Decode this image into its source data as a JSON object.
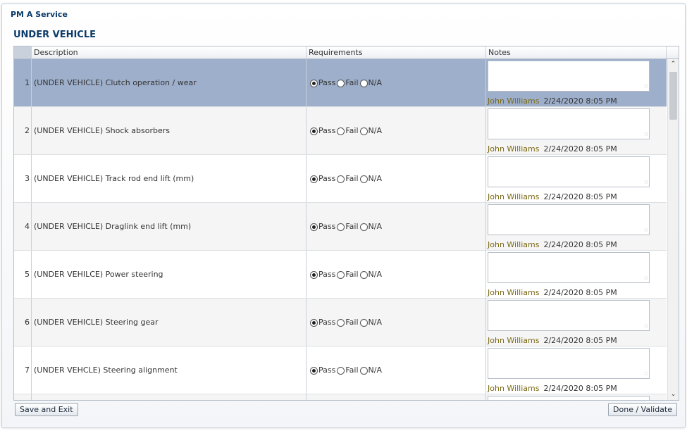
{
  "window": {
    "title": "PM A Service"
  },
  "section": {
    "title": "UNDER VEHICLE"
  },
  "table": {
    "columns": [
      "Description",
      "Requirements",
      "Notes"
    ],
    "radio_labels": [
      "Pass",
      "Fail",
      "N/A"
    ],
    "rows": [
      {
        "num": "1",
        "description": "(UNDER VEHICLE) Clutch operation / wear",
        "selected_option": "Pass",
        "note_text": "",
        "user": "John Williams",
        "date": "2/24/2020 8:05 PM",
        "highlight": true
      },
      {
        "num": "2",
        "description": "(UNDER VEHICLE) Shock absorbers",
        "selected_option": "Pass",
        "note_text": "",
        "user": "John Williams",
        "date": "2/24/2020 8:05 PM"
      },
      {
        "num": "3",
        "description": "(UNDER VEHICLE) Track rod end lift (mm)",
        "selected_option": "Pass",
        "note_text": "",
        "user": "John Williams",
        "date": "2/24/2020 8:05 PM"
      },
      {
        "num": "4",
        "description": "(UNDER VEHICLE) Draglink end lift (mm)",
        "selected_option": "Pass",
        "note_text": "",
        "user": "John Williams",
        "date": "2/24/2020 8:05 PM"
      },
      {
        "num": "5",
        "description": "(UNDER VEHILCE) Power steering",
        "selected_option": "Pass",
        "note_text": "",
        "user": "John Williams",
        "date": "2/24/2020 8:05 PM"
      },
      {
        "num": "6",
        "description": "(UNDER VEHICLE) Steering gear",
        "selected_option": "Pass",
        "note_text": "",
        "user": "John Williams",
        "date": "2/24/2020 8:05 PM"
      },
      {
        "num": "7",
        "description": "(UNDER VEHCLE) Steering alignment",
        "selected_option": "Pass",
        "note_text": "",
        "user": "John Williams",
        "date": "2/24/2020 8:05 PM"
      },
      {
        "num": "",
        "description": "",
        "selected_option": "",
        "note_text": "",
        "user": "",
        "date": ""
      }
    ]
  },
  "buttons": {
    "save_exit": "Save and Exit",
    "done_validate": "Done / Validate"
  },
  "colors": {
    "selected_row": "#9eafcb",
    "alt_row": "#f5f5f5",
    "title": "#0b3c6b",
    "user_name": "#7a6a14"
  },
  "icons": {
    "scroll_up": "chevron-up-icon",
    "scroll_down": "chevron-down-icon",
    "resize_grip": "resize-grip-icon"
  }
}
